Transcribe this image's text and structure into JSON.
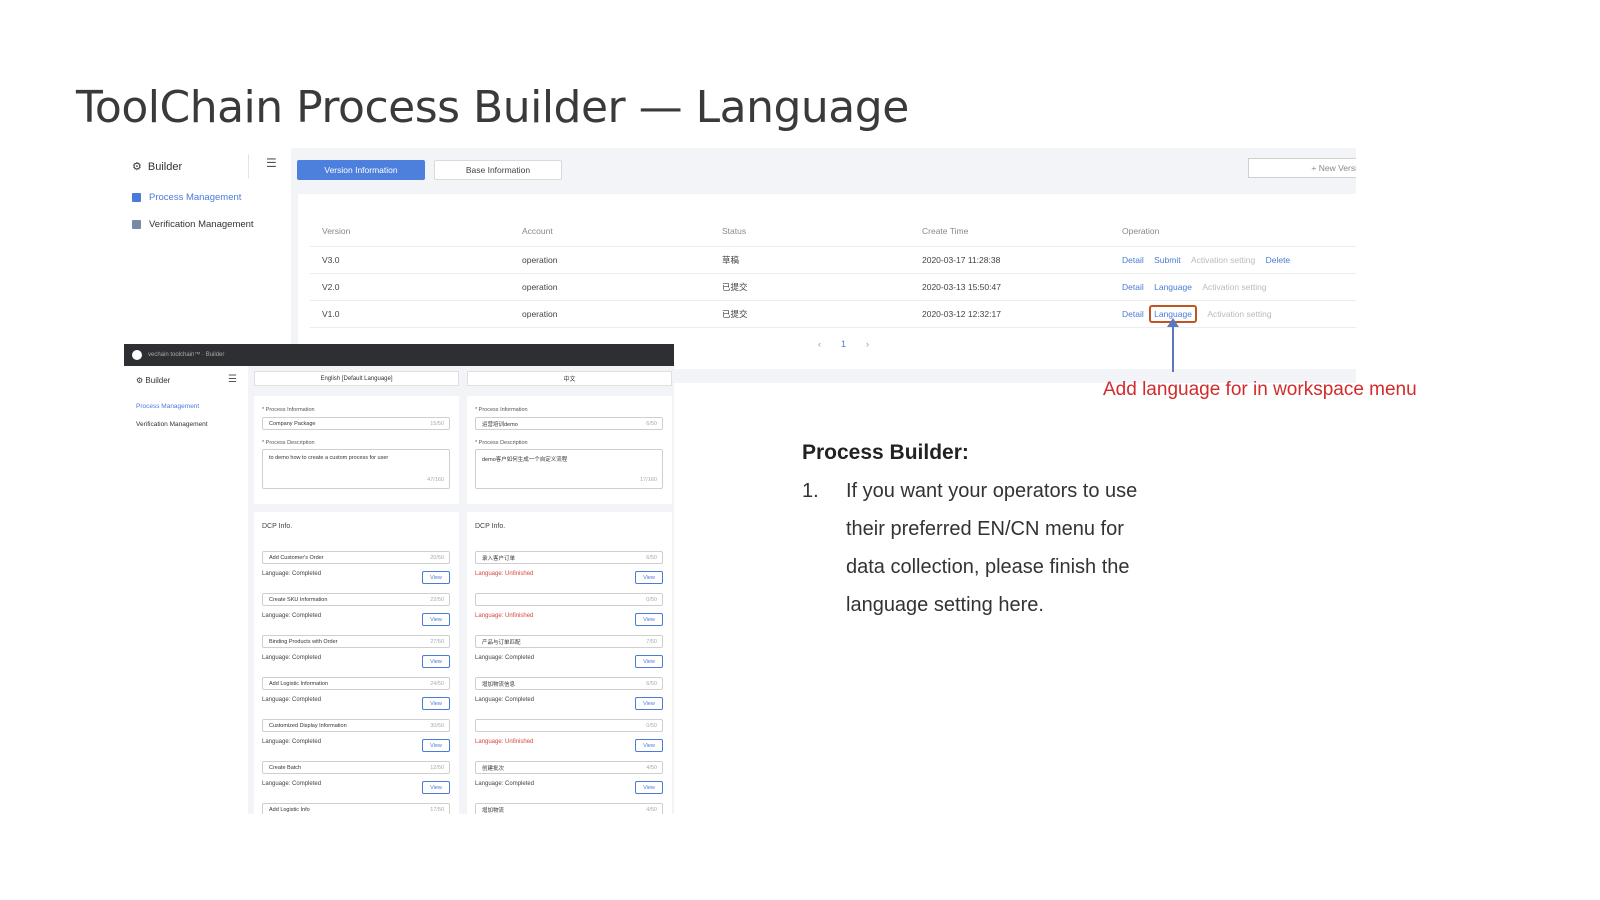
{
  "slide": {
    "title": "ToolChain Process Builder — Language",
    "annotation": "Add language for in workspace menu",
    "heading": "Process Builder:",
    "item_number": "1.",
    "item_lines": [
      "If you want your operators to use",
      "their preferred EN/CN menu for",
      "data collection, please finish the",
      "language setting here."
    ]
  },
  "colors": {
    "accent": "#4d80dd",
    "annotation": "#d22b2b",
    "highlight_box": "#c1541f",
    "arrow": "#5b79bf"
  },
  "screen1": {
    "brand": "Builder",
    "burger_icon": "menu-icon",
    "nav": [
      {
        "label": "Process Management",
        "icon": "briefcase-icon",
        "active": true
      },
      {
        "label": "Verification Management",
        "icon": "clipboard-icon",
        "active": false
      }
    ],
    "tabs": {
      "version": "Version Information",
      "base": "Base Information"
    },
    "new_version": "+ New Versi",
    "columns": [
      "Version",
      "Account",
      "Status",
      "Create Time",
      "Operation"
    ],
    "rows": [
      {
        "version": "V3.0",
        "account": "operation",
        "status": "草稿",
        "time": "2020-03-17 11:28:38",
        "ops": [
          "Detail",
          "Submit",
          "Activation setting",
          "Delete"
        ]
      },
      {
        "version": "V2.0",
        "account": "operation",
        "status": "已提交",
        "time": "2020-03-13 15:50:47",
        "ops": [
          "Detail",
          "Language",
          "Activation setting"
        ]
      },
      {
        "version": "V1.0",
        "account": "operation",
        "status": "已提交",
        "time": "2020-03-12 12:32:17",
        "ops": [
          "Detail",
          "Language",
          "Activation setting"
        ]
      }
    ],
    "pager": {
      "prev": "‹",
      "page": "1",
      "next": "›"
    }
  },
  "screen2": {
    "topbar": "vechain toolchain™ · Builder",
    "brand": "Builder",
    "nav": [
      "Process Management",
      "Verification Management"
    ],
    "tabs": {
      "en": "English [Default Language]",
      "cn": "中文"
    },
    "en": {
      "process_info_label": "* Process Information",
      "process_name": "Company Package",
      "process_name_count": "15/50",
      "desc_label": "* Process Description",
      "desc": "to demo how to create a custom process for user",
      "desc_count": "47/160",
      "dcp_title": "DCP Info.",
      "items": [
        {
          "name": "Add Customer's Order",
          "count": "20/50",
          "status": "Language: Completed"
        },
        {
          "name": "Create SKU Information",
          "count": "22/50",
          "status": "Language: Completed"
        },
        {
          "name": "Binding Products with Order",
          "count": "27/50",
          "status": "Language: Completed"
        },
        {
          "name": "Add Logistic Information",
          "count": "24/50",
          "status": "Language: Completed"
        },
        {
          "name": "Customized Display Information",
          "count": "30/50",
          "status": "Language: Completed"
        },
        {
          "name": "Create Batch",
          "count": "12/50",
          "status": "Language: Completed"
        }
      ],
      "last_item": "Add Logistic Info",
      "last_count": "17/50"
    },
    "cn": {
      "process_info_label": "* Process Information",
      "process_name": "运营培训demo",
      "process_name_count": "6/50",
      "desc_label": "* Process Description",
      "desc": "demo客户如何生成一个自定义流程",
      "desc_count": "17/160",
      "dcp_title": "DCP Info.",
      "items": [
        {
          "name": "录入客户订单",
          "count": "6/50",
          "status": "Language: Unfinished",
          "bad": true
        },
        {
          "name": "",
          "count": "0/50",
          "status": "Language: Unfinished",
          "bad": true
        },
        {
          "name": "产品与订单匹配",
          "count": "7/50",
          "status": "Language: Completed",
          "bad": false
        },
        {
          "name": "增加物流信息",
          "count": "6/50",
          "status": "Language: Completed",
          "bad": false
        },
        {
          "name": "",
          "count": "0/50",
          "status": "Language: Unfinished",
          "bad": true
        },
        {
          "name": "创建批次",
          "count": "4/50",
          "status": "Language: Completed",
          "bad": false
        }
      ],
      "last_item": "增加物流",
      "last_count": "4/50"
    },
    "view_label": "View"
  }
}
